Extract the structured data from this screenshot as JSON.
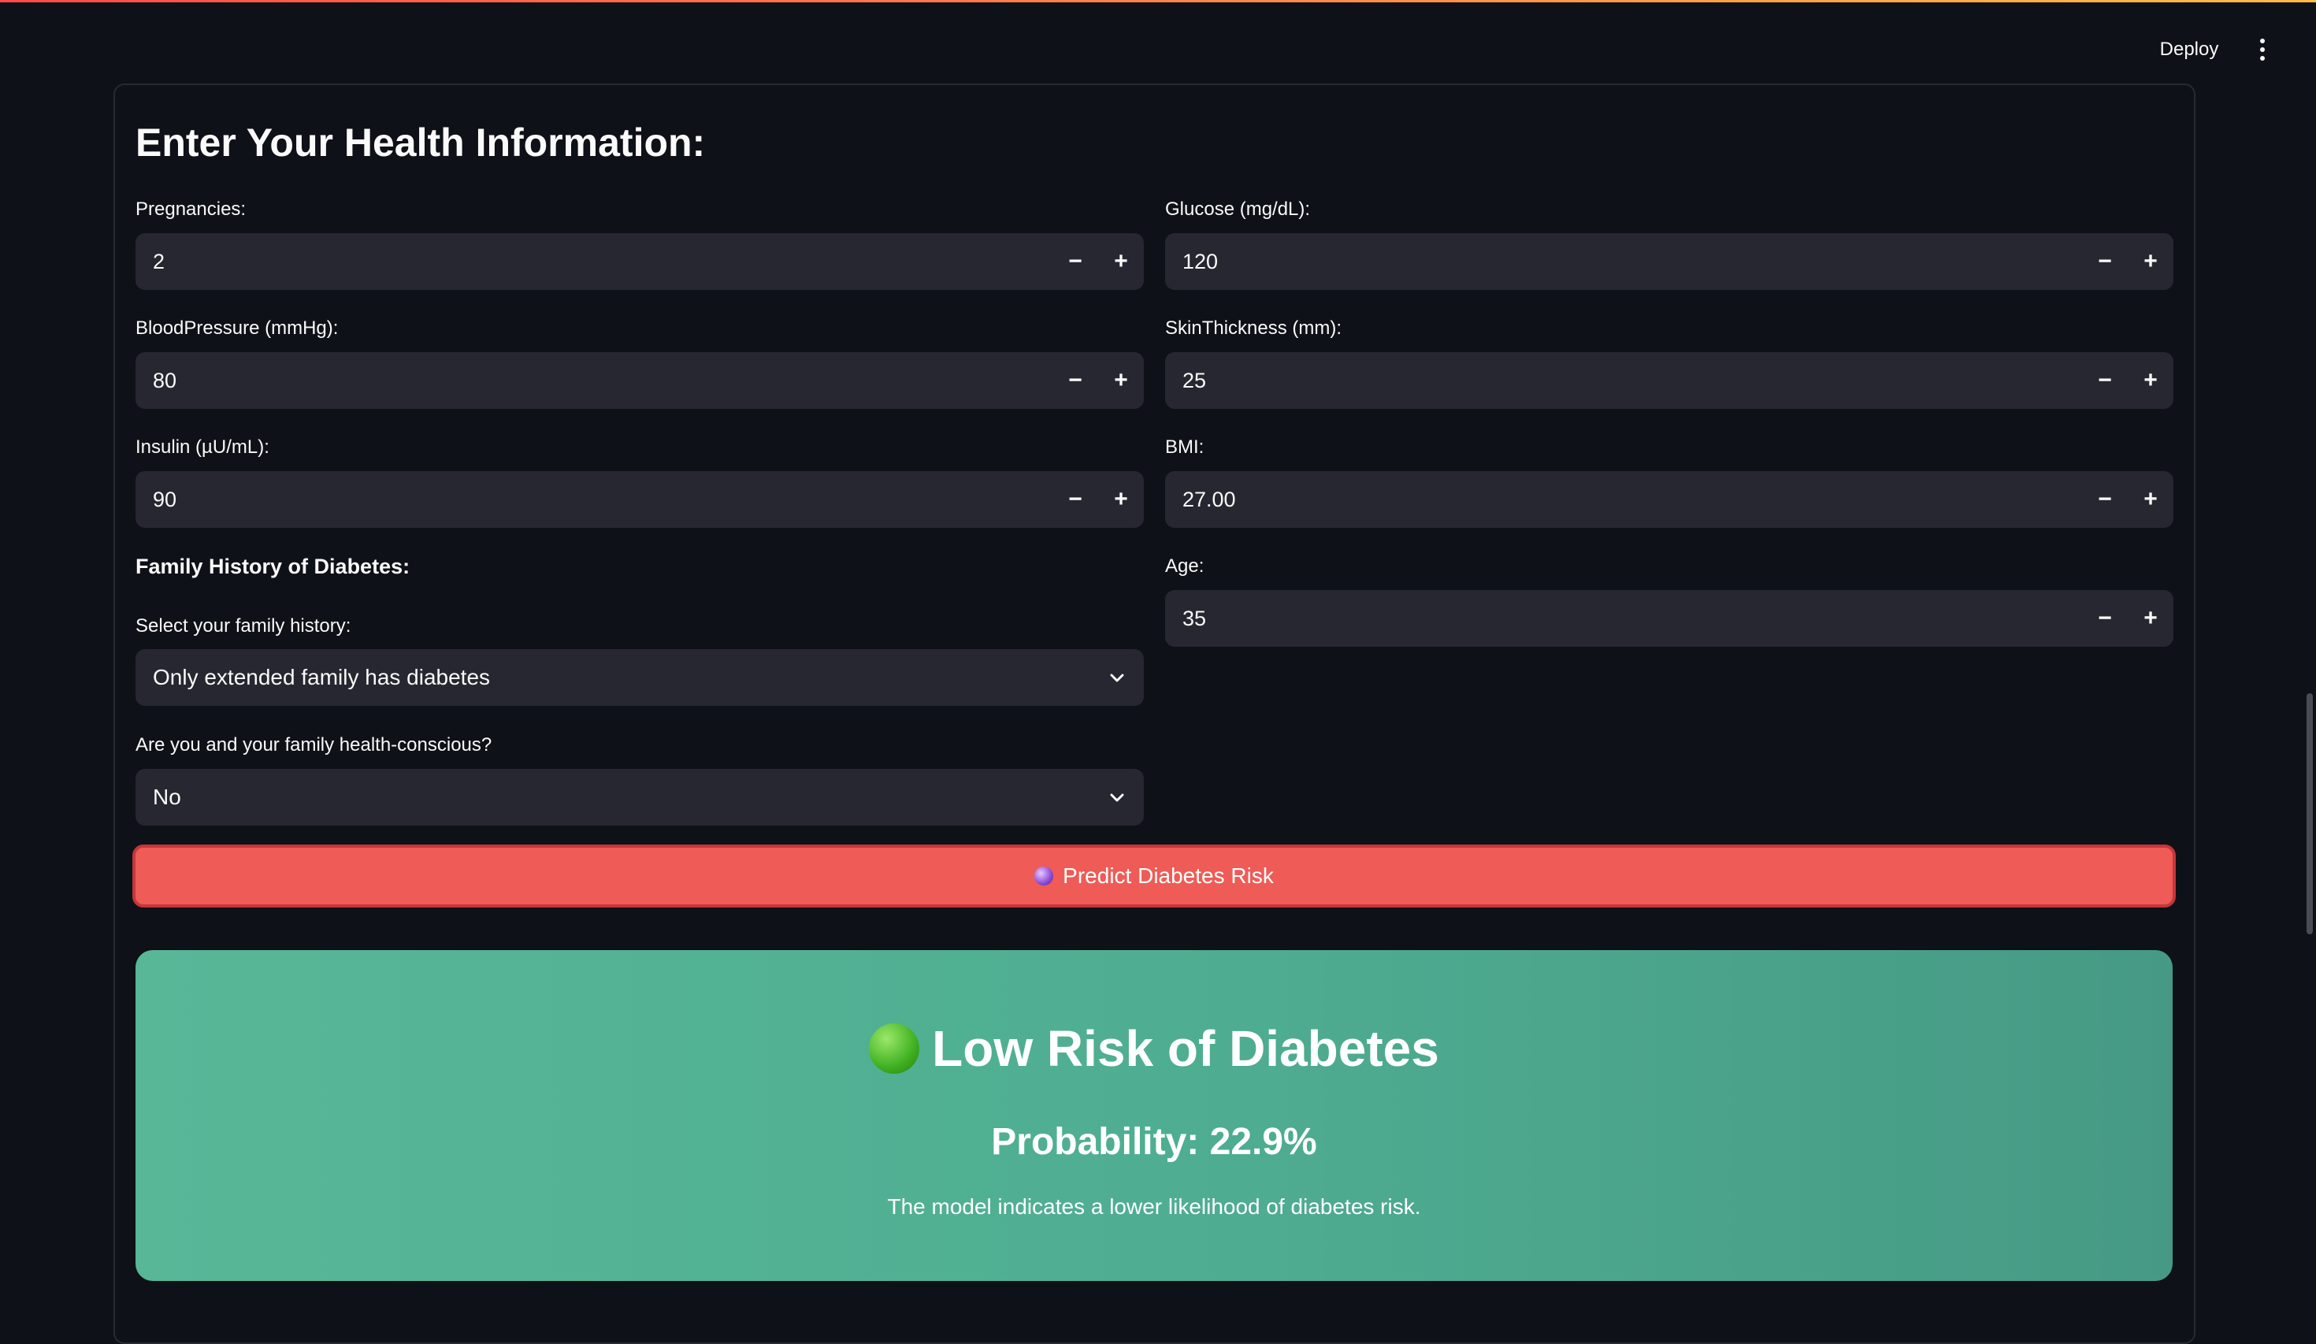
{
  "toolbar": {
    "deploy_label": "Deploy",
    "menu_icon": "kebab-menu-icon"
  },
  "form": {
    "title": "Enter Your Health Information:",
    "fields": {
      "pregnancies": {
        "label": "Pregnancies:",
        "value": "2"
      },
      "glucose": {
        "label": "Glucose (mg/dL):",
        "value": "120"
      },
      "blood_pressure": {
        "label": "BloodPressure (mmHg):",
        "value": "80"
      },
      "skin_thickness": {
        "label": "SkinThickness (mm):",
        "value": "25"
      },
      "insulin": {
        "label": "Insulin (µU/mL):",
        "value": "90"
      },
      "bmi": {
        "label": "BMI:",
        "value": "27.00"
      },
      "age": {
        "label": "Age:",
        "value": "35"
      }
    },
    "stepper": {
      "minus": "−",
      "plus": "+"
    },
    "family_section": {
      "heading": "Family History of Diabetes:",
      "history_label": "Select your family history:",
      "history_value": "Only extended family has diabetes",
      "conscious_label": "Are you and your family health-conscious?",
      "conscious_value": "No"
    },
    "predict_label": "Predict Diabetes Risk",
    "predict_icon": "crystal-ball-icon"
  },
  "result": {
    "icon": "green-circle-icon",
    "title": "Low Risk of Diabetes",
    "probability": "Probability: 22.9%",
    "message": "The model indicates a lower likelihood of diabetes risk.",
    "color": "#4fae91"
  },
  "colors": {
    "background": "#0e1117",
    "input": "#262730",
    "button": "#ef5b56"
  }
}
